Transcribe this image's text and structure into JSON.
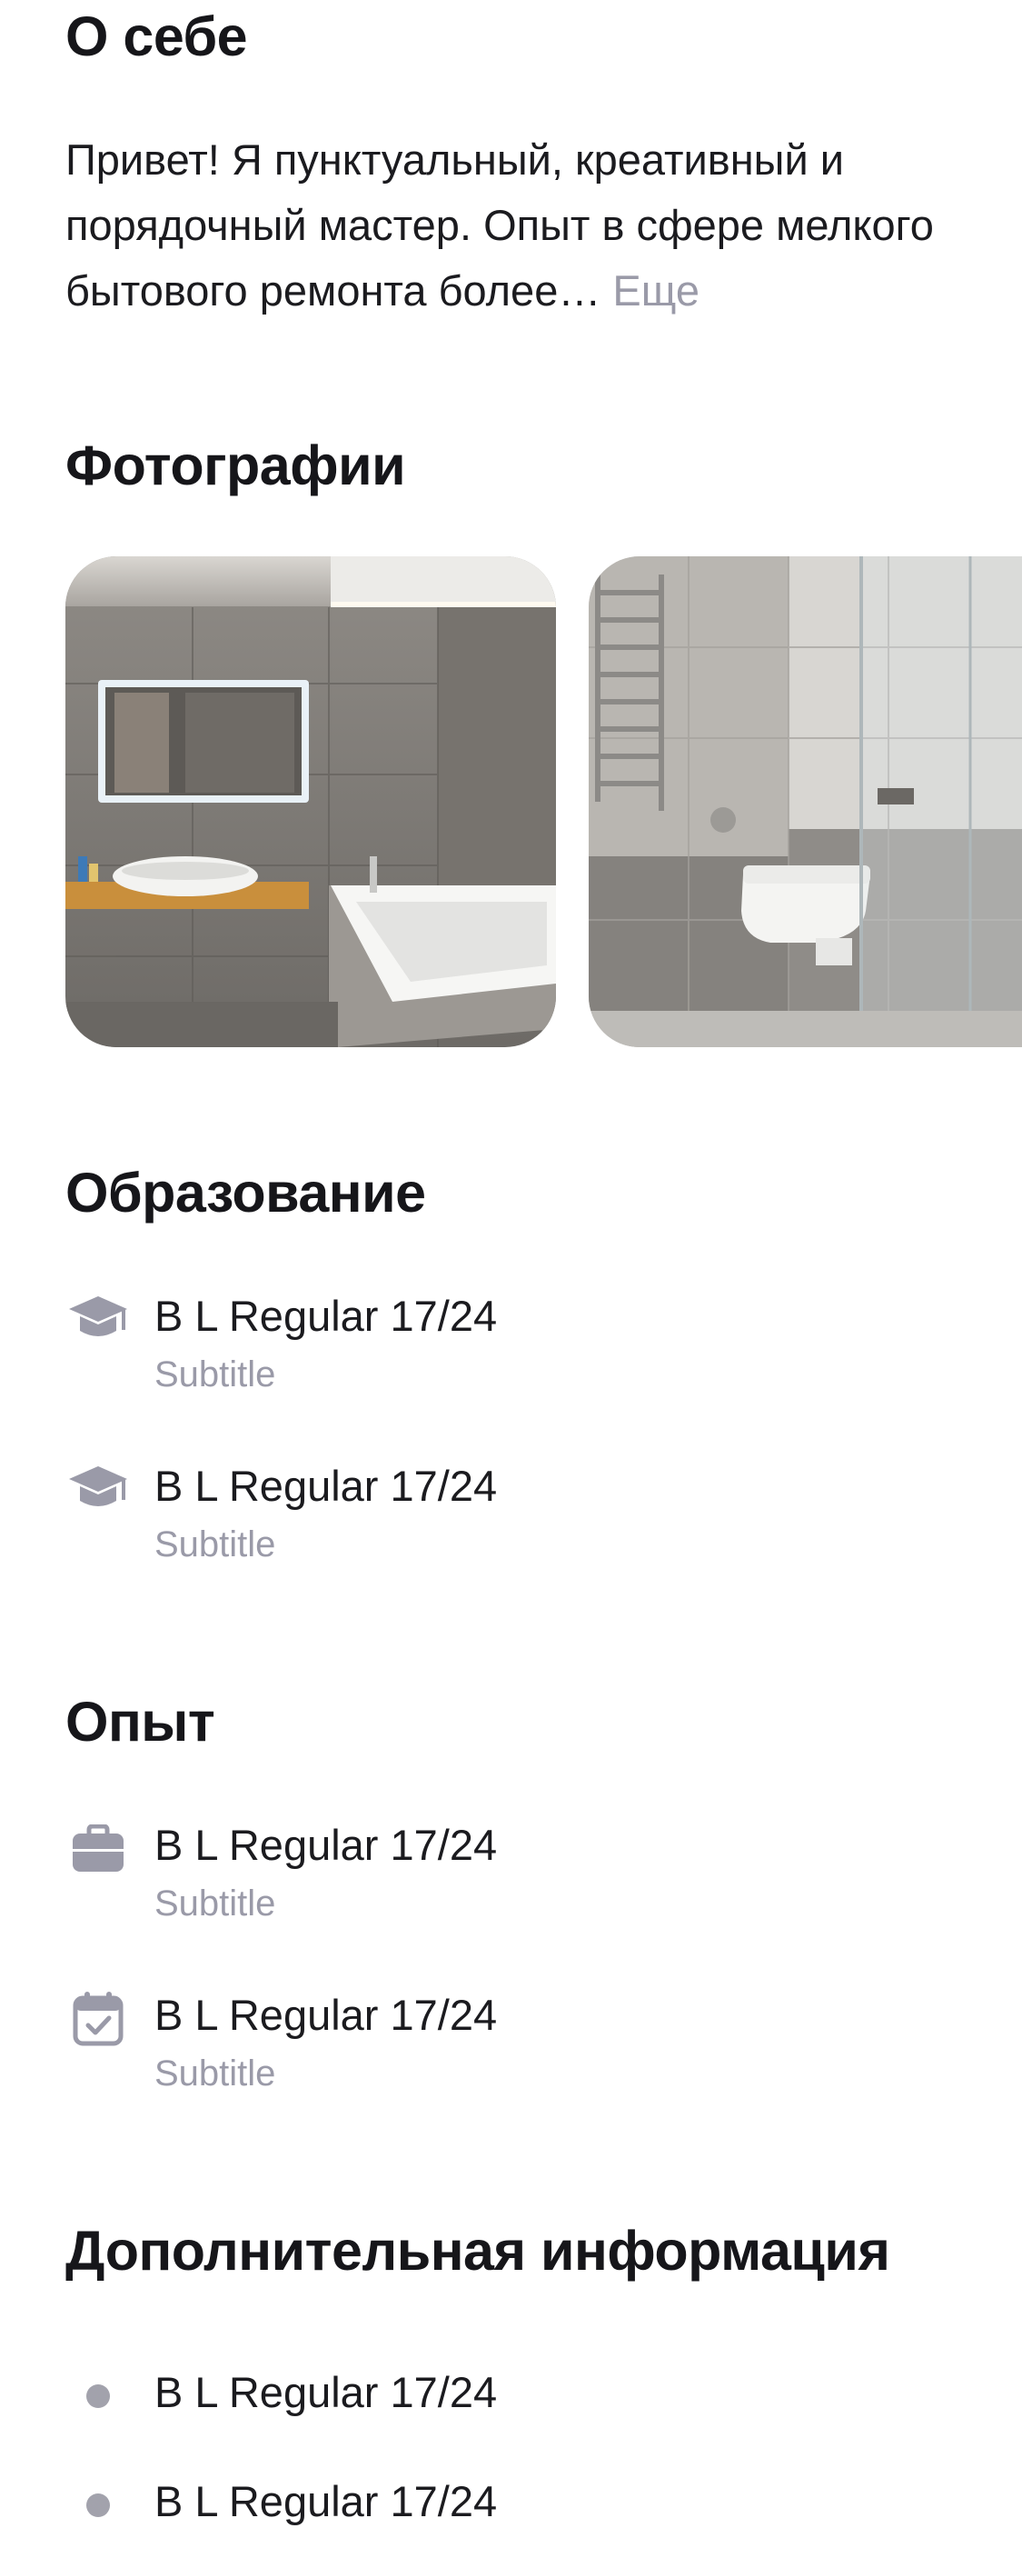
{
  "about": {
    "heading": "О себе",
    "text": "Привет! Я пунктуальный, креативный и порядочный мастер. Опыт в сфере мелкого бытового ремонта более…",
    "more_label": "Еще"
  },
  "photos": {
    "heading": "Фотографии",
    "items": [
      {
        "icon": "bathroom-photo-1"
      },
      {
        "icon": "bathroom-photo-2"
      }
    ]
  },
  "education": {
    "heading": "Образование",
    "items": [
      {
        "icon": "graduation-cap-icon",
        "title": "B L Regular 17/24",
        "subtitle": "Subtitle"
      },
      {
        "icon": "graduation-cap-icon",
        "title": "B L Regular 17/24",
        "subtitle": "Subtitle"
      }
    ]
  },
  "experience": {
    "heading": "Опыт",
    "items": [
      {
        "icon": "briefcase-icon",
        "title": "B L Regular 17/24",
        "subtitle": "Subtitle"
      },
      {
        "icon": "calendar-check-icon",
        "title": "B L Regular 17/24",
        "subtitle": "Subtitle"
      }
    ]
  },
  "additional": {
    "heading": "Дополнительная информация",
    "items": [
      {
        "icon": "bullet-dot",
        "title": "B L Regular 17/24"
      },
      {
        "icon": "bullet-dot",
        "title": "B L Regular 17/24"
      }
    ]
  },
  "colors": {
    "text_primary": "#1b1b1f",
    "text_secondary": "#9a9aa8",
    "icon_gray": "#9a9aa8",
    "background": "#ffffff"
  }
}
